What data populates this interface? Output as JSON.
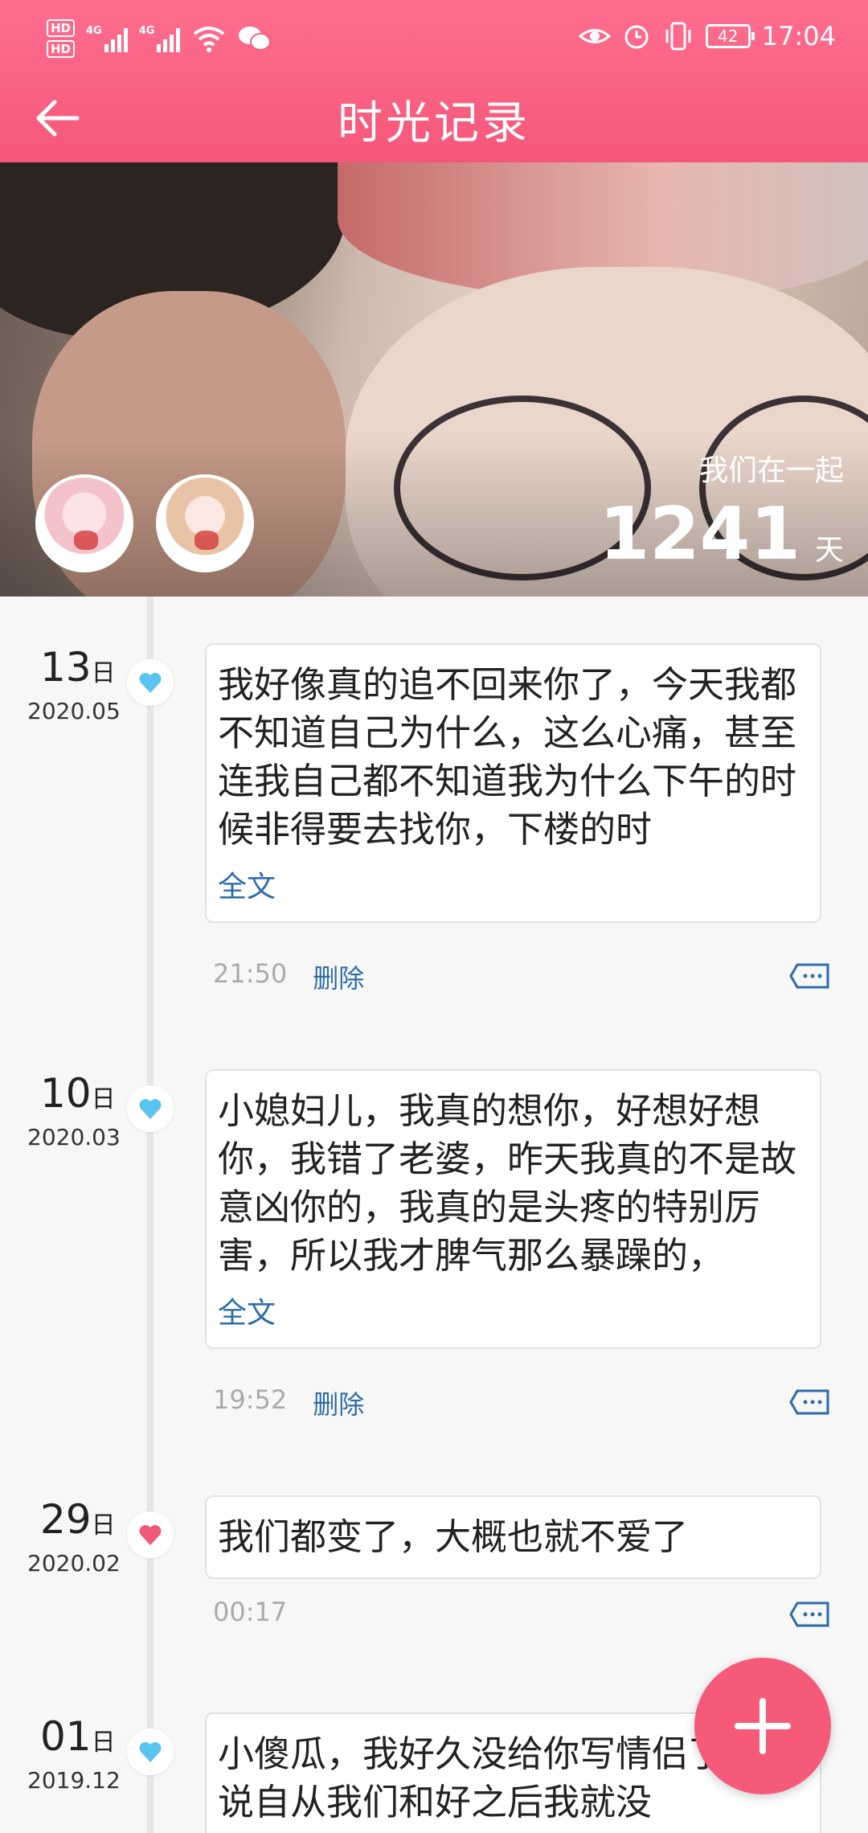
{
  "status_bar": {
    "sim1": "HD",
    "sim2": "HD",
    "net1": "4G",
    "net2": "4G",
    "battery": "42",
    "time": "17:04"
  },
  "header": {
    "title": "时光记录",
    "back_icon": "back-arrow-icon"
  },
  "banner": {
    "together_label": "我们在一起",
    "days": "1241",
    "days_unit": "天"
  },
  "colors": {
    "accent": "#f5577a",
    "link": "#2d6ca8",
    "heart_blue": "#5ac4f0",
    "heart_red": "#f05a78"
  },
  "timeline": {
    "day_suffix": "日",
    "entries": [
      {
        "day": "13",
        "year_month": "2020.05",
        "heart": "blue",
        "text": "我好像真的追不回来你了，今天我都不知道自己为什么，这么心痛，甚至连我自己都不知道我为什么下午的时候非得要去找你，下楼的时",
        "full_label": "全文",
        "time": "21:50",
        "delete_label": "删除"
      },
      {
        "day": "10",
        "year_month": "2020.03",
        "heart": "blue",
        "text": "小媳妇儿，我真的想你，好想好想你，我错了老婆，昨天我真的不是故意凶你的，我真的是头疼的特别厉害，所以我才脾气那么暴躁的，",
        "full_label": "全文",
        "time": "19:52",
        "delete_label": "删除"
      },
      {
        "day": "29",
        "year_month": "2020.02",
        "heart": "red",
        "text": "我们都变了，大概也就不爱了",
        "time": "00:17"
      },
      {
        "day": "01",
        "year_month": "2019.12",
        "heart": "blue",
        "text": "小傻瓜，我好久没给你写情侣了，你说自从我们和好之后我就没"
      }
    ]
  },
  "fab": {
    "icon": "plus-icon"
  }
}
